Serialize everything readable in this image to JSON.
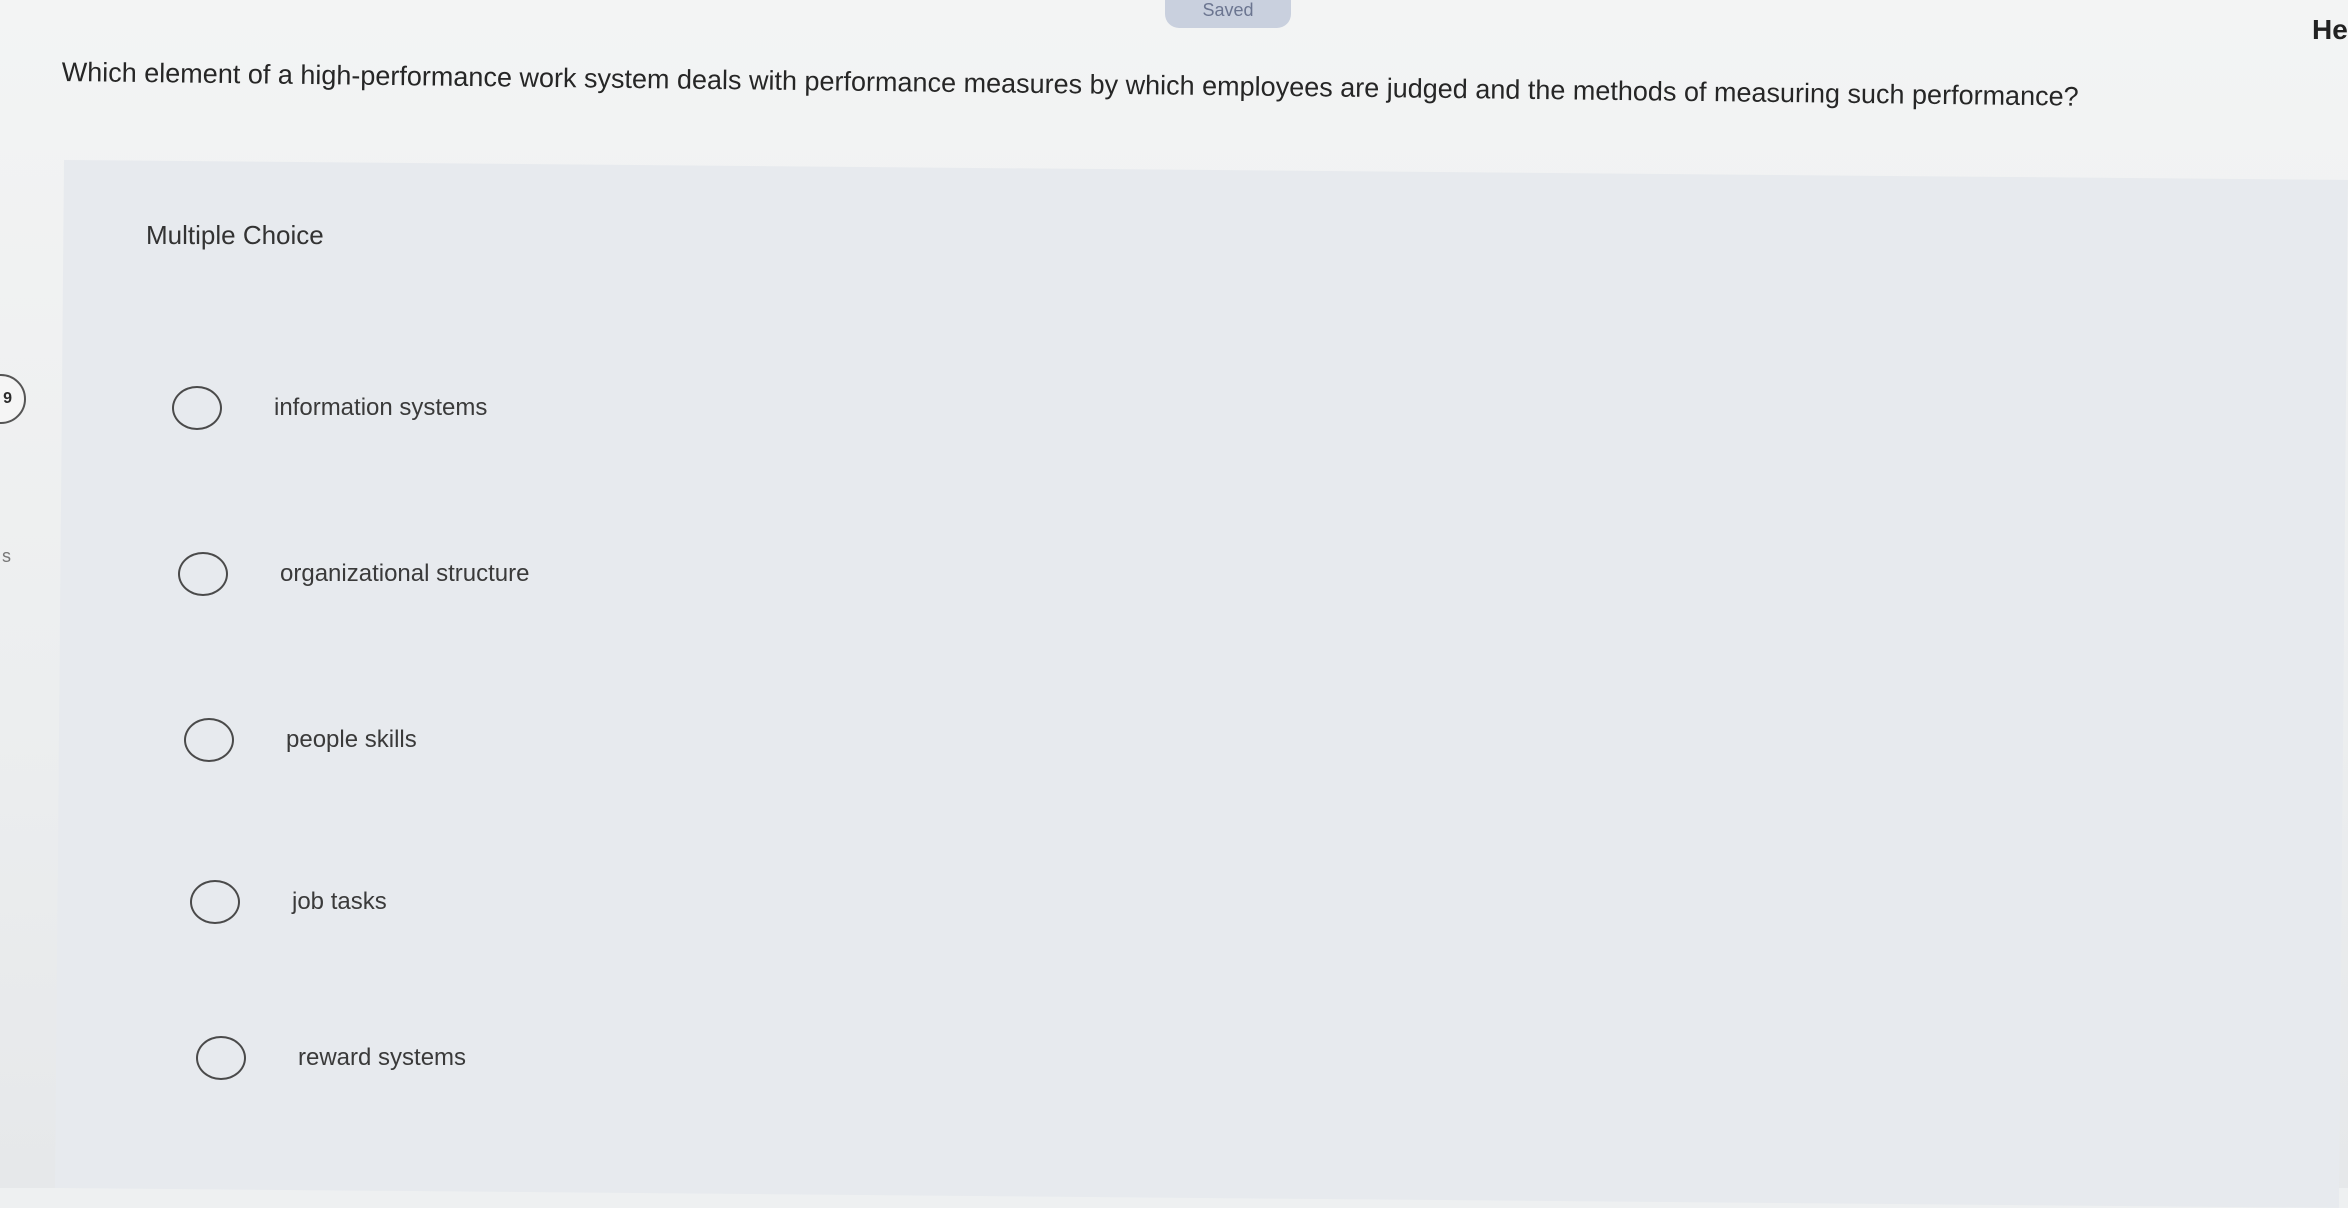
{
  "header": {
    "saved_label": "Saved",
    "help_label": "He"
  },
  "question": {
    "text": "Which element of a high-performance work system deals with performance measures by which employees are judged and the methods of measuring such performance?"
  },
  "answers": {
    "section_label": "Multiple Choice",
    "options": [
      {
        "label": "information systems"
      },
      {
        "label": "organizational structure"
      },
      {
        "label": "people skills"
      },
      {
        "label": "job tasks"
      },
      {
        "label": "reward systems"
      }
    ]
  },
  "sidebar": {
    "badge_text": "9",
    "partial_text": "s"
  }
}
